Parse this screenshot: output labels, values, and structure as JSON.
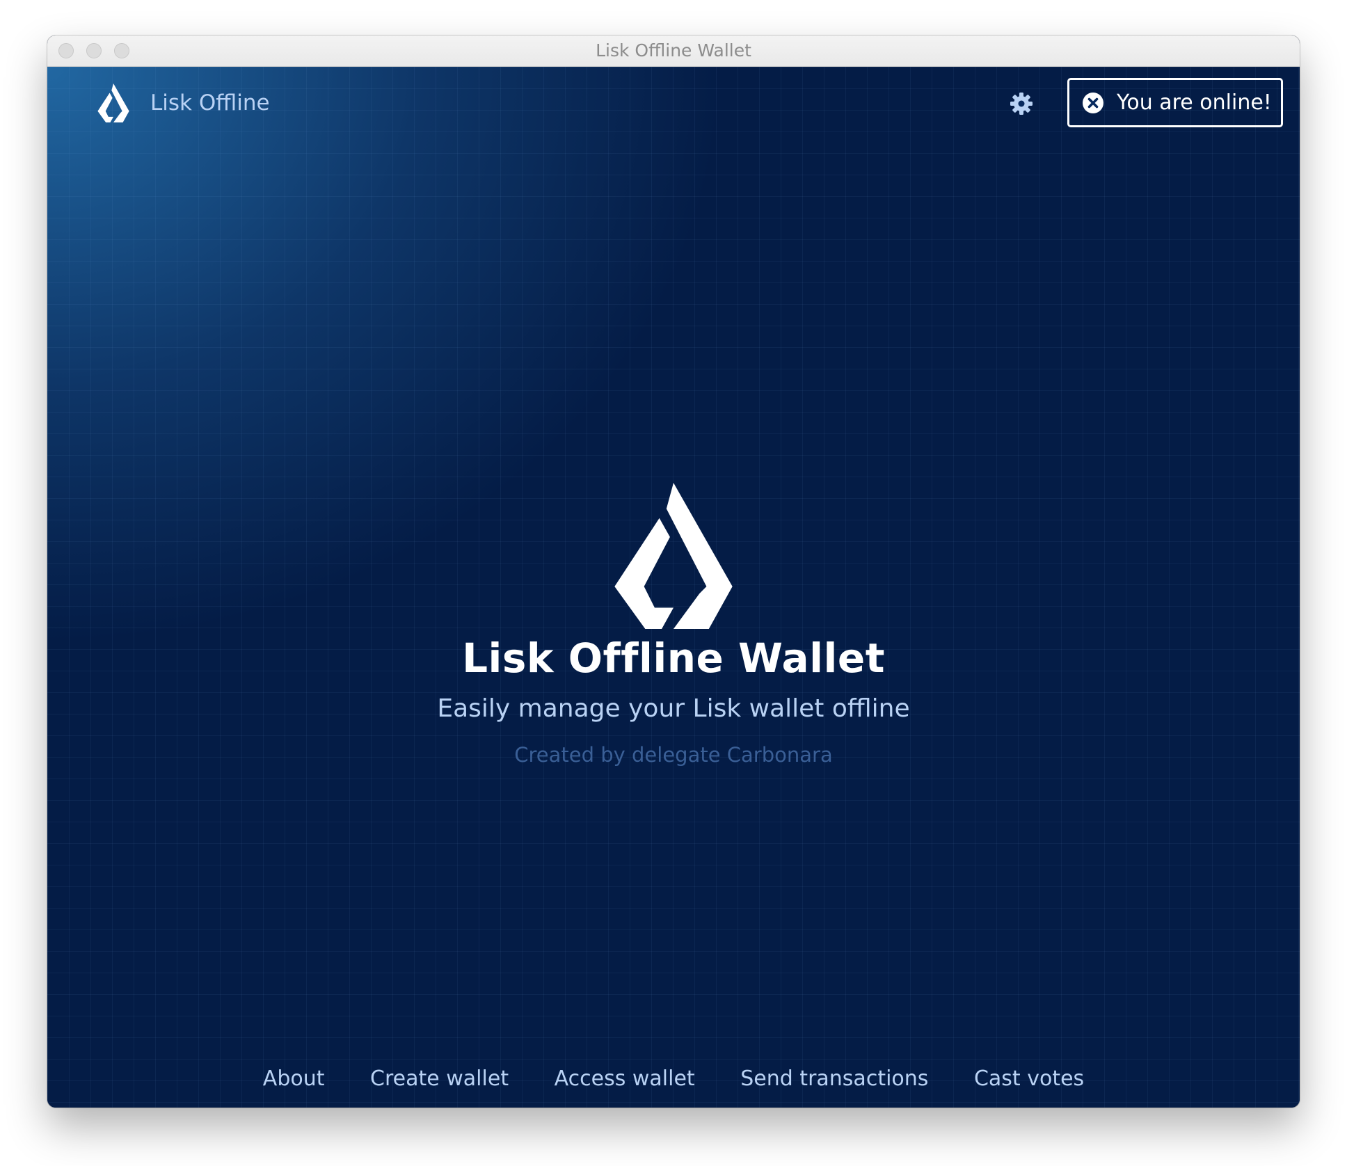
{
  "window": {
    "title": "Lisk Offline Wallet"
  },
  "header": {
    "brand_label": "Lisk Offline",
    "brand_icon": "lisk-logo-icon",
    "settings_icon": "gear-icon",
    "status_button": {
      "label": "You are online!",
      "icon": "close-circle-icon"
    }
  },
  "hero": {
    "logo_icon": "lisk-logo-icon",
    "title": "Lisk Offline Wallet",
    "subtitle": "Easily manage your Lisk wallet offline",
    "credit": "Created by delegate Carbonara"
  },
  "footer": {
    "links": [
      {
        "label": "About"
      },
      {
        "label": "Create wallet"
      },
      {
        "label": "Access wallet"
      },
      {
        "label": "Send transactions"
      },
      {
        "label": "Cast votes"
      }
    ]
  },
  "colors": {
    "background": "#041c46",
    "accent_light": "#b9d2f4",
    "credit_text": "#3a5f96",
    "white": "#ffffff"
  }
}
